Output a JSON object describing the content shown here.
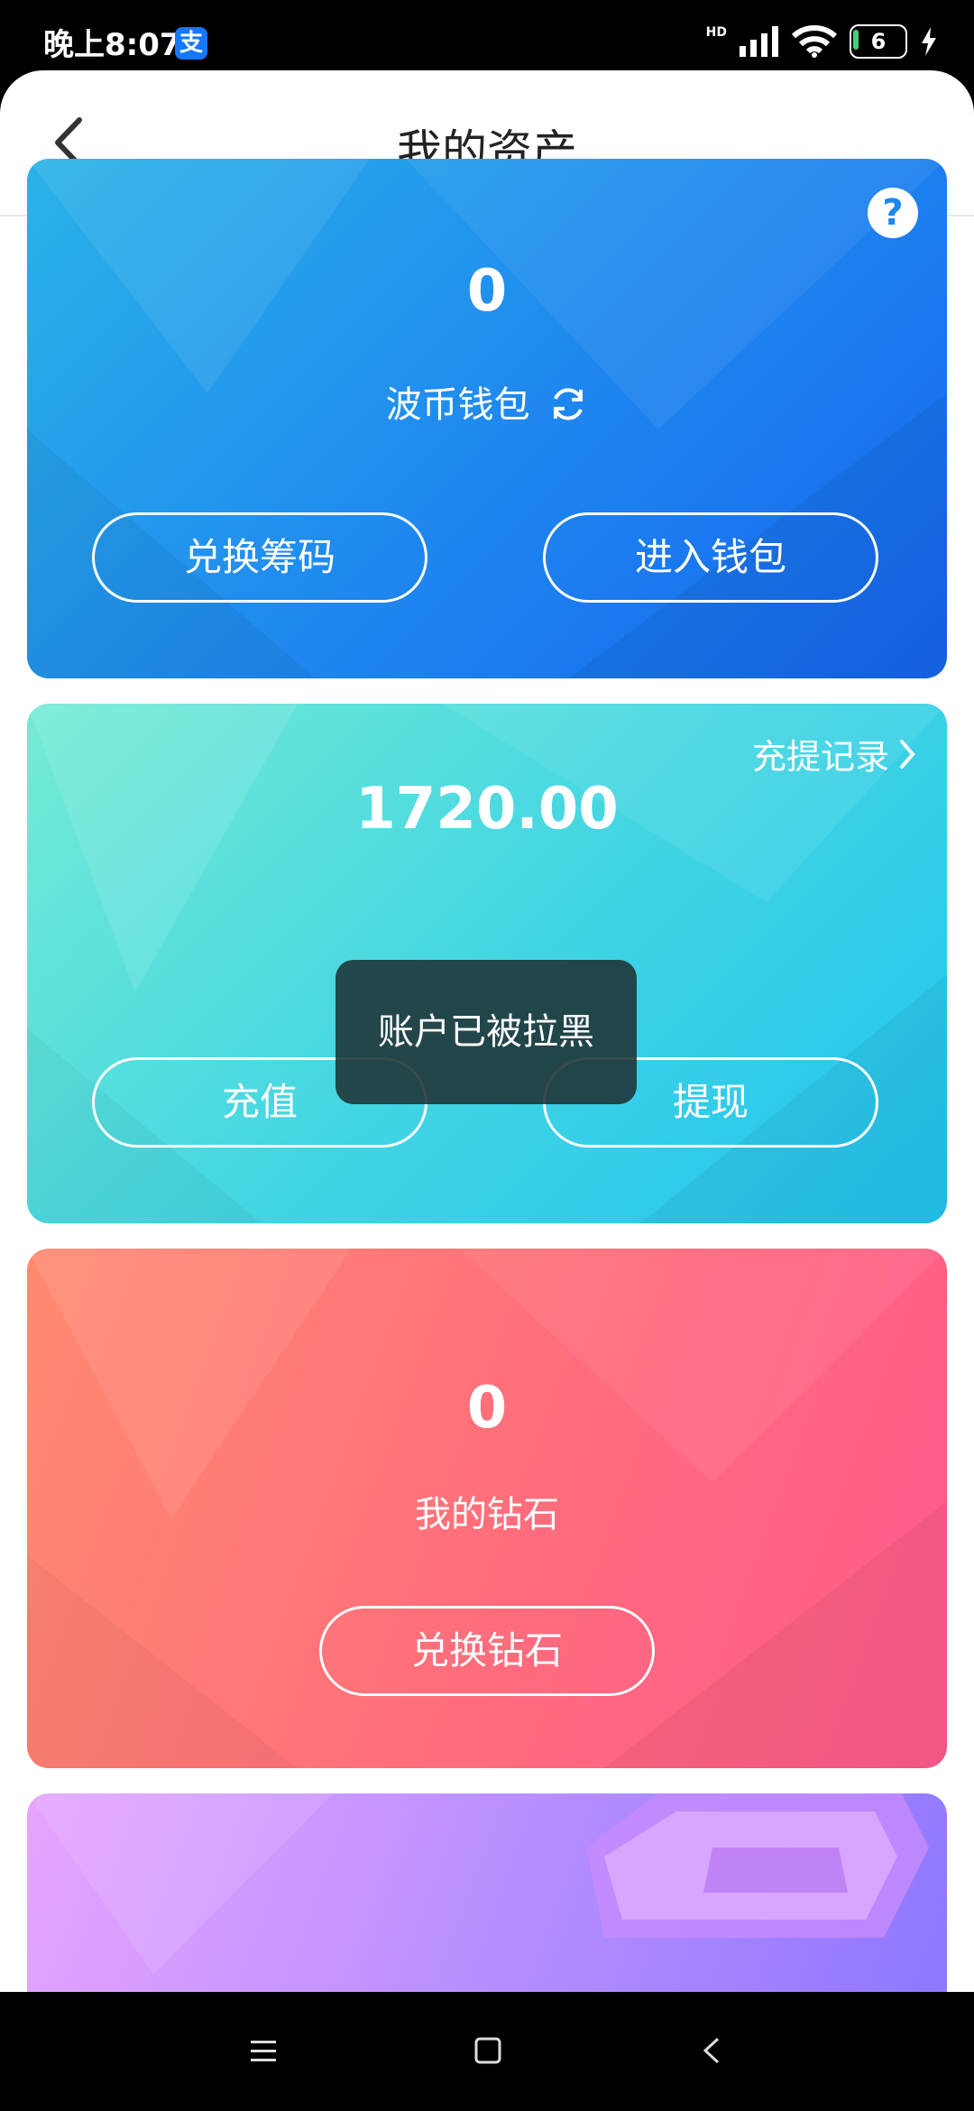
{
  "status_bar": {
    "time": "晚上8:07",
    "alipay_badge": "支",
    "network": "HD",
    "battery": "6",
    "icons": [
      "signal-icon",
      "wifi-icon",
      "battery-icon",
      "charging-icon"
    ]
  },
  "header": {
    "title": "我的资产"
  },
  "wallet_card": {
    "amount": "0",
    "label": "波币钱包",
    "help": "?",
    "buttons": {
      "exchange": "兑换筹码",
      "enter": "进入钱包"
    }
  },
  "balance_card": {
    "record_link": "充提记录",
    "amount": "1720.00",
    "buttons": {
      "recharge": "充值",
      "withdraw": "提现"
    }
  },
  "diamond_card": {
    "amount": "0",
    "label": "我的钻石",
    "button": "兑换钻石"
  },
  "toast": {
    "message": "账户已被拉黑"
  },
  "colors": {
    "wallet_gradient": [
      "#2ab3e8",
      "#1565ee"
    ],
    "balance_gradient": [
      "#74ebd5",
      "#22c3f0"
    ],
    "diamond_gradient": [
      "#ff8a70",
      "#ff5a8c"
    ],
    "purple_gradient": [
      "#e7a4ff",
      "#8c76ff"
    ]
  }
}
